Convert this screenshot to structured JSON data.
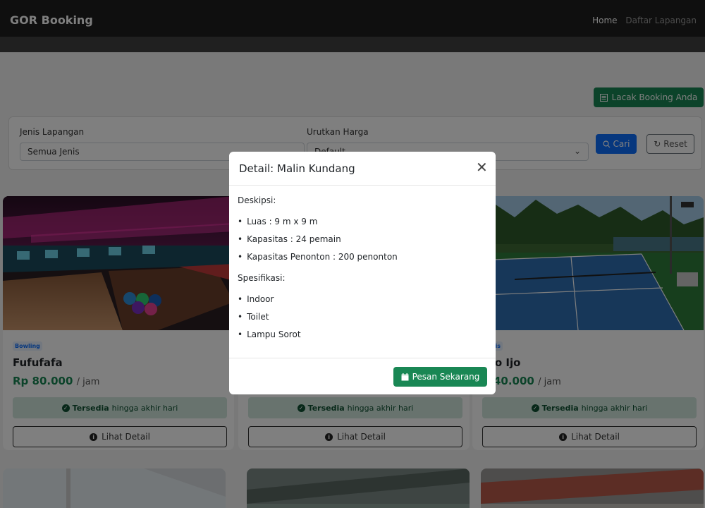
{
  "navbar": {
    "brand": "GOR Booking",
    "links": [
      "Home",
      "Daftar Lapangan"
    ]
  },
  "track_button": {
    "icon": "list-icon",
    "label": "Lacak Booking Anda"
  },
  "filters": {
    "jenis_label": "Jenis Lapangan",
    "jenis_value": "Semua Jenis",
    "urutan_label": "Urutkan Harga",
    "urutan_value": "Default",
    "search_label": "Cari",
    "reset_label": "Reset"
  },
  "cards": [
    {
      "badge": "Bowling",
      "title": "Fufufafa",
      "price": "Rp 80.000",
      "unit": "/ jam",
      "availability_bold": "Tersedia",
      "availability_rest": "hingga akhir hari",
      "detail_label": "Lihat Detail"
    },
    {
      "badge": "",
      "title": "",
      "price": "",
      "unit": "",
      "availability_bold": "Tersedia",
      "availability_rest": "hingga akhir hari",
      "detail_label": "Lihat Detail"
    },
    {
      "badge": "Tenis",
      "title": "uto Ijo",
      "price": "p 40.000",
      "unit": "/ jam",
      "availability_bold": "Tersedia",
      "availability_rest": "hingga akhir hari",
      "detail_label": "Lihat Detail"
    }
  ],
  "modal": {
    "title": "Detail: Malin Kundang",
    "description_label": "Deskipsi:",
    "description_items": [
      "Luas : 9 m x 9 m",
      "Kapasitas : 24 pemain",
      "Kapasitas Penonton : 200 penonton"
    ],
    "spec_label": "Spesifikasi:",
    "spec_items": [
      "Indoor",
      "Toilet",
      "Lampu Sorot"
    ],
    "book_label": "Pesan Sekarang"
  },
  "colors": {
    "primary": "#0d6efd",
    "success": "#198754",
    "navbar": "#1f1f1f"
  }
}
